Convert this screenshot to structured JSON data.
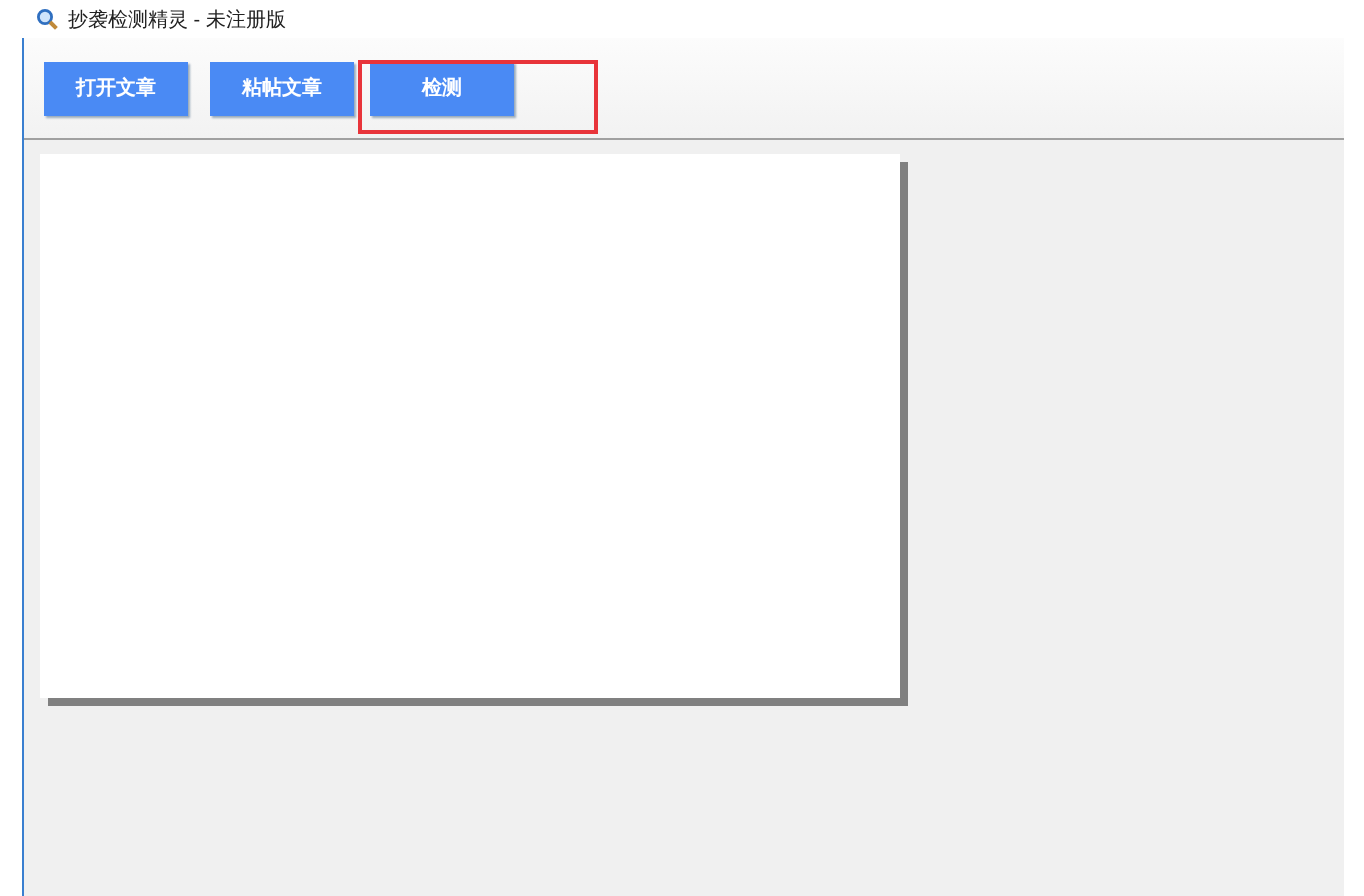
{
  "window": {
    "title": "抄袭检测精灵 - 未注册版"
  },
  "toolbar": {
    "buttons": [
      {
        "label": "打开文章",
        "highlighted": false
      },
      {
        "label": "粘帖文章",
        "highlighted": false
      },
      {
        "label": "检测",
        "highlighted": true
      }
    ]
  }
}
